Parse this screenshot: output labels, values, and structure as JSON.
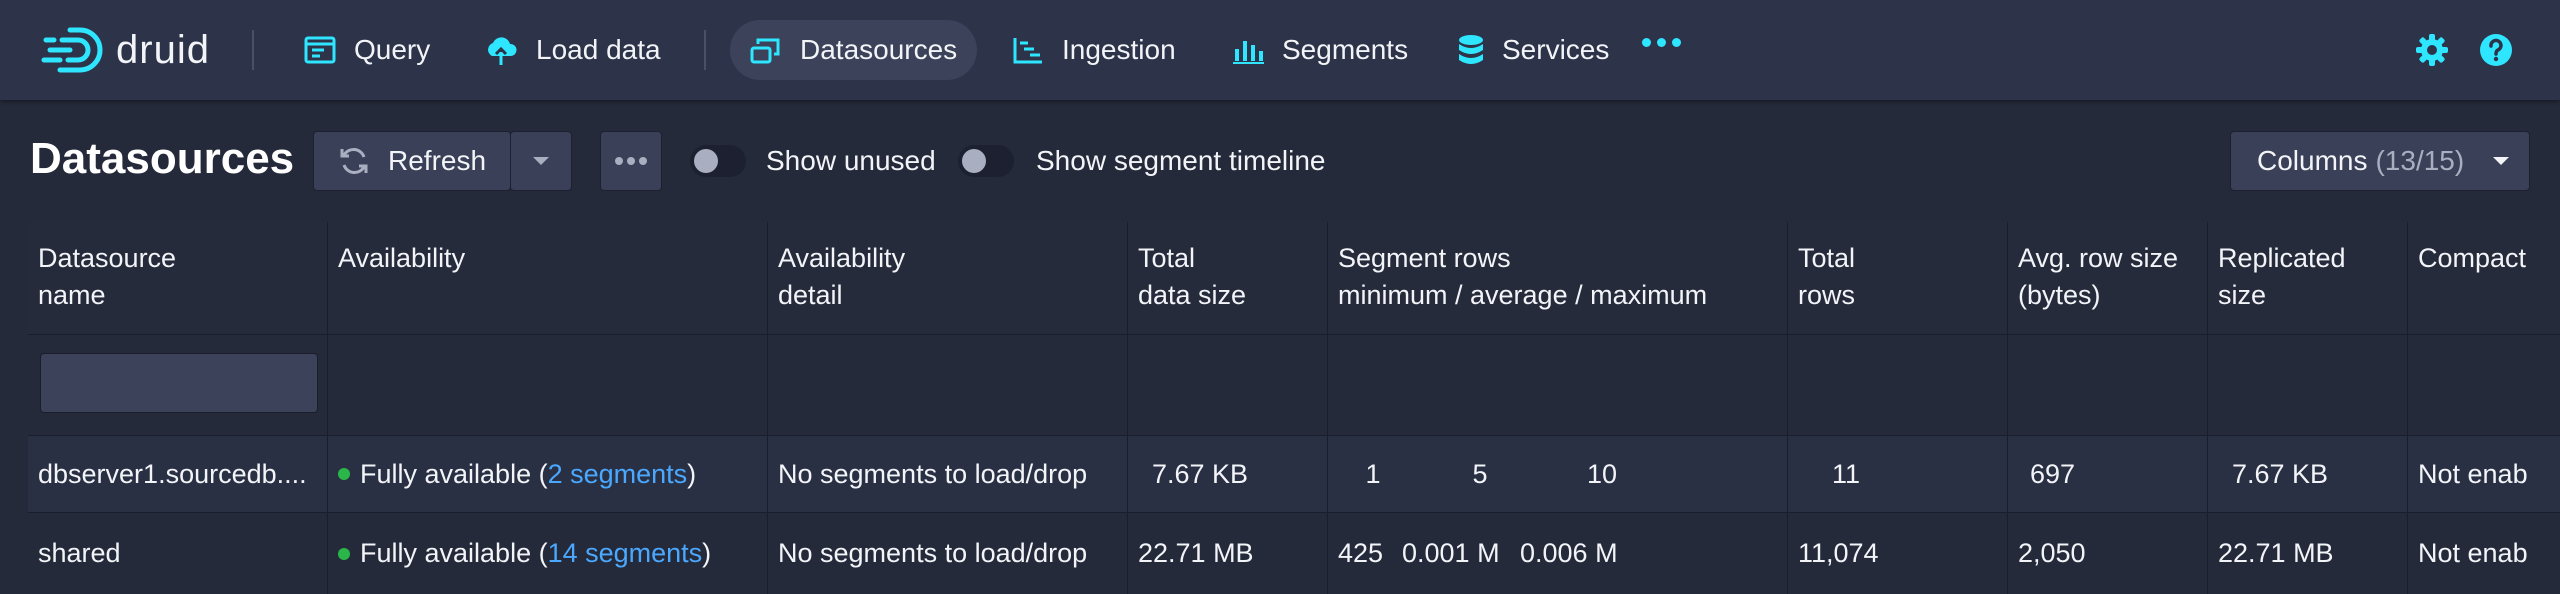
{
  "brand": {
    "name": "druid"
  },
  "nav": {
    "items": [
      {
        "label": "Query",
        "icon": "console-icon"
      },
      {
        "label": "Load data",
        "icon": "cloud-upload-icon"
      },
      {
        "label": "Datasources",
        "icon": "multi-select-icon",
        "active": true
      },
      {
        "label": "Ingestion",
        "icon": "gantt-chart-icon"
      },
      {
        "label": "Segments",
        "icon": "stacked-chart-icon"
      },
      {
        "label": "Services",
        "icon": "database-icon"
      }
    ],
    "more_icon": "more-icon",
    "right_icons": [
      "gear-icon",
      "help-icon"
    ]
  },
  "colors": {
    "accent": "#2ee6ff",
    "link": "#4aa8ff",
    "status_ok": "#2ab648",
    "background": "#252a3a",
    "nav_bg": "#2d3349"
  },
  "page": {
    "title": "Datasources"
  },
  "toolbar": {
    "refresh_label": "Refresh",
    "show_unused_label": "Show unused",
    "show_timeline_label": "Show segment timeline",
    "columns_label": "Columns",
    "columns_count": "(13/15)"
  },
  "table": {
    "headers": [
      [
        "Datasource",
        "name"
      ],
      [
        "Availability",
        ""
      ],
      [
        "Availability",
        "detail"
      ],
      [
        "Total",
        "data size"
      ],
      [
        "Segment rows",
        "minimum / average / maximum"
      ],
      [
        "Total",
        "rows"
      ],
      [
        "Avg. row size",
        "(bytes)"
      ],
      [
        "Replicated",
        "size"
      ],
      [
        "Compact",
        ""
      ]
    ],
    "filter_placeholder": "",
    "rows": [
      {
        "name": "dbserver1.sourcedb....",
        "availability_prefix": "Fully available (",
        "availability_link": "2 segments",
        "availability_suffix": ")",
        "detail": "No segments to load/drop",
        "data_size": "7.67 KB",
        "seg_min": "1",
        "seg_avg": "5",
        "seg_max": "10",
        "total_rows": "11",
        "avg_row_size": "697",
        "replicated_size": "7.67 KB",
        "compaction": "Not enab"
      },
      {
        "name": "shared",
        "availability_prefix": "Fully available (",
        "availability_link": "14 segments",
        "availability_suffix": ")",
        "detail": "No segments to load/drop",
        "data_size": "22.71 MB",
        "seg_min": "425",
        "seg_avg": "0.001 M",
        "seg_max": "0.006 M",
        "total_rows": "11,074",
        "avg_row_size": "2,050",
        "replicated_size": "22.71 MB",
        "compaction": "Not enab"
      }
    ]
  }
}
